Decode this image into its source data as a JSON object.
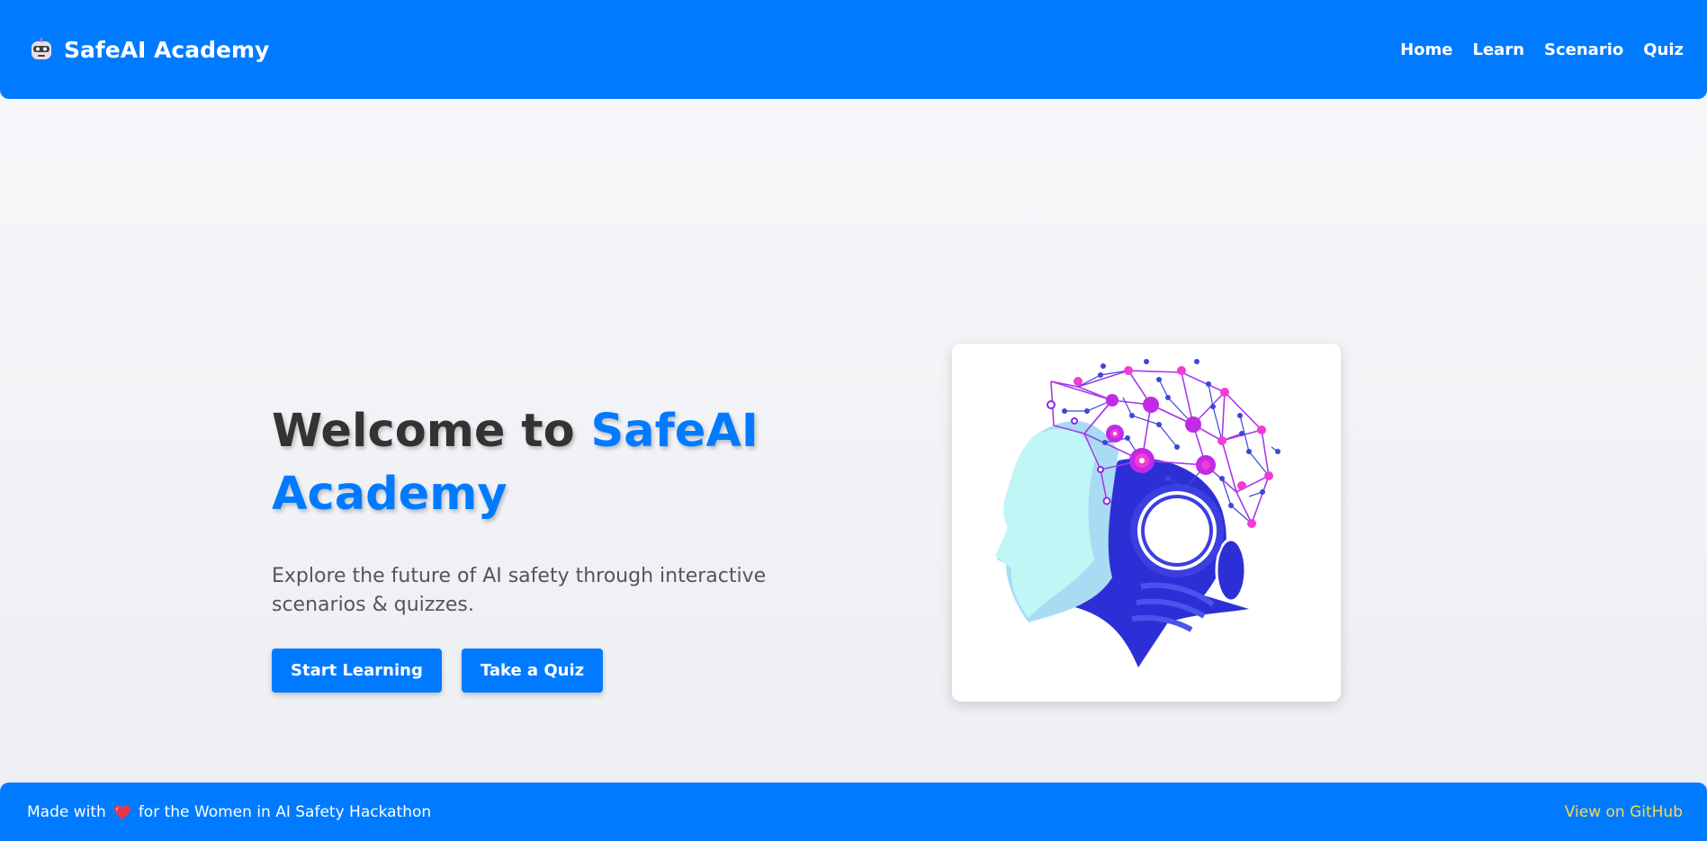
{
  "nav": {
    "brand": "SafeAI Academy",
    "links": [
      "Home",
      "Learn",
      "Scenario",
      "Quiz"
    ]
  },
  "hero": {
    "headline_prefix": "Welcome to ",
    "headline_accent": "SafeAI Academy",
    "subtitle": "Explore the future of AI safety through interactive scenarios & quizzes.",
    "primary_button": "Start Learning",
    "secondary_button": "Take a Quiz"
  },
  "footer": {
    "made_with": "Made with",
    "heart_icon": "heart-icon",
    "dedication": "for the Women in AI Safety Hackathon",
    "github_link": "View on GitHub"
  },
  "colors": {
    "brand_blue": "#007bff",
    "heading_text": "#333333",
    "footer_link": "#ffd64d"
  }
}
